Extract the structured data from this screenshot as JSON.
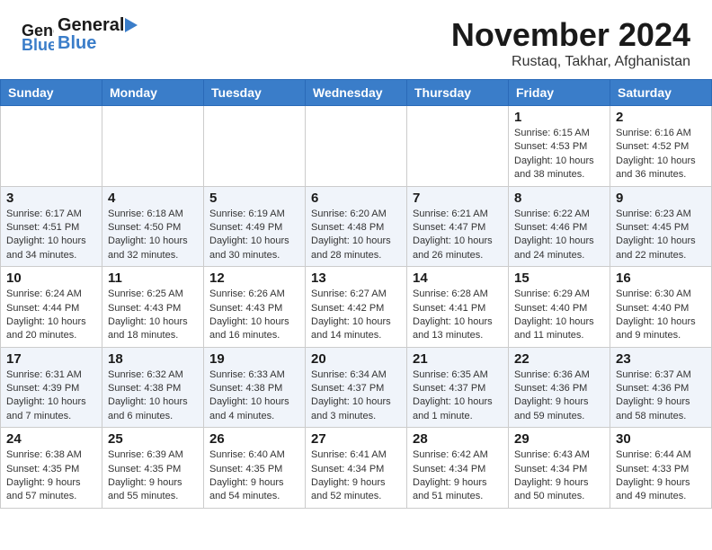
{
  "header": {
    "logo_general": "General",
    "logo_blue": "Blue",
    "month_title": "November 2024",
    "location": "Rustaq, Takhar, Afghanistan"
  },
  "weekdays": [
    "Sunday",
    "Monday",
    "Tuesday",
    "Wednesday",
    "Thursday",
    "Friday",
    "Saturday"
  ],
  "weeks": [
    [
      {
        "day": "",
        "info": ""
      },
      {
        "day": "",
        "info": ""
      },
      {
        "day": "",
        "info": ""
      },
      {
        "day": "",
        "info": ""
      },
      {
        "day": "",
        "info": ""
      },
      {
        "day": "1",
        "info": "Sunrise: 6:15 AM\nSunset: 4:53 PM\nDaylight: 10 hours and 38 minutes."
      },
      {
        "day": "2",
        "info": "Sunrise: 6:16 AM\nSunset: 4:52 PM\nDaylight: 10 hours and 36 minutes."
      }
    ],
    [
      {
        "day": "3",
        "info": "Sunrise: 6:17 AM\nSunset: 4:51 PM\nDaylight: 10 hours and 34 minutes."
      },
      {
        "day": "4",
        "info": "Sunrise: 6:18 AM\nSunset: 4:50 PM\nDaylight: 10 hours and 32 minutes."
      },
      {
        "day": "5",
        "info": "Sunrise: 6:19 AM\nSunset: 4:49 PM\nDaylight: 10 hours and 30 minutes."
      },
      {
        "day": "6",
        "info": "Sunrise: 6:20 AM\nSunset: 4:48 PM\nDaylight: 10 hours and 28 minutes."
      },
      {
        "day": "7",
        "info": "Sunrise: 6:21 AM\nSunset: 4:47 PM\nDaylight: 10 hours and 26 minutes."
      },
      {
        "day": "8",
        "info": "Sunrise: 6:22 AM\nSunset: 4:46 PM\nDaylight: 10 hours and 24 minutes."
      },
      {
        "day": "9",
        "info": "Sunrise: 6:23 AM\nSunset: 4:45 PM\nDaylight: 10 hours and 22 minutes."
      }
    ],
    [
      {
        "day": "10",
        "info": "Sunrise: 6:24 AM\nSunset: 4:44 PM\nDaylight: 10 hours and 20 minutes."
      },
      {
        "day": "11",
        "info": "Sunrise: 6:25 AM\nSunset: 4:43 PM\nDaylight: 10 hours and 18 minutes."
      },
      {
        "day": "12",
        "info": "Sunrise: 6:26 AM\nSunset: 4:43 PM\nDaylight: 10 hours and 16 minutes."
      },
      {
        "day": "13",
        "info": "Sunrise: 6:27 AM\nSunset: 4:42 PM\nDaylight: 10 hours and 14 minutes."
      },
      {
        "day": "14",
        "info": "Sunrise: 6:28 AM\nSunset: 4:41 PM\nDaylight: 10 hours and 13 minutes."
      },
      {
        "day": "15",
        "info": "Sunrise: 6:29 AM\nSunset: 4:40 PM\nDaylight: 10 hours and 11 minutes."
      },
      {
        "day": "16",
        "info": "Sunrise: 6:30 AM\nSunset: 4:40 PM\nDaylight: 10 hours and 9 minutes."
      }
    ],
    [
      {
        "day": "17",
        "info": "Sunrise: 6:31 AM\nSunset: 4:39 PM\nDaylight: 10 hours and 7 minutes."
      },
      {
        "day": "18",
        "info": "Sunrise: 6:32 AM\nSunset: 4:38 PM\nDaylight: 10 hours and 6 minutes."
      },
      {
        "day": "19",
        "info": "Sunrise: 6:33 AM\nSunset: 4:38 PM\nDaylight: 10 hours and 4 minutes."
      },
      {
        "day": "20",
        "info": "Sunrise: 6:34 AM\nSunset: 4:37 PM\nDaylight: 10 hours and 3 minutes."
      },
      {
        "day": "21",
        "info": "Sunrise: 6:35 AM\nSunset: 4:37 PM\nDaylight: 10 hours and 1 minute."
      },
      {
        "day": "22",
        "info": "Sunrise: 6:36 AM\nSunset: 4:36 PM\nDaylight: 9 hours and 59 minutes."
      },
      {
        "day": "23",
        "info": "Sunrise: 6:37 AM\nSunset: 4:36 PM\nDaylight: 9 hours and 58 minutes."
      }
    ],
    [
      {
        "day": "24",
        "info": "Sunrise: 6:38 AM\nSunset: 4:35 PM\nDaylight: 9 hours and 57 minutes."
      },
      {
        "day": "25",
        "info": "Sunrise: 6:39 AM\nSunset: 4:35 PM\nDaylight: 9 hours and 55 minutes."
      },
      {
        "day": "26",
        "info": "Sunrise: 6:40 AM\nSunset: 4:35 PM\nDaylight: 9 hours and 54 minutes."
      },
      {
        "day": "27",
        "info": "Sunrise: 6:41 AM\nSunset: 4:34 PM\nDaylight: 9 hours and 52 minutes."
      },
      {
        "day": "28",
        "info": "Sunrise: 6:42 AM\nSunset: 4:34 PM\nDaylight: 9 hours and 51 minutes."
      },
      {
        "day": "29",
        "info": "Sunrise: 6:43 AM\nSunset: 4:34 PM\nDaylight: 9 hours and 50 minutes."
      },
      {
        "day": "30",
        "info": "Sunrise: 6:44 AM\nSunset: 4:33 PM\nDaylight: 9 hours and 49 minutes."
      }
    ]
  ]
}
